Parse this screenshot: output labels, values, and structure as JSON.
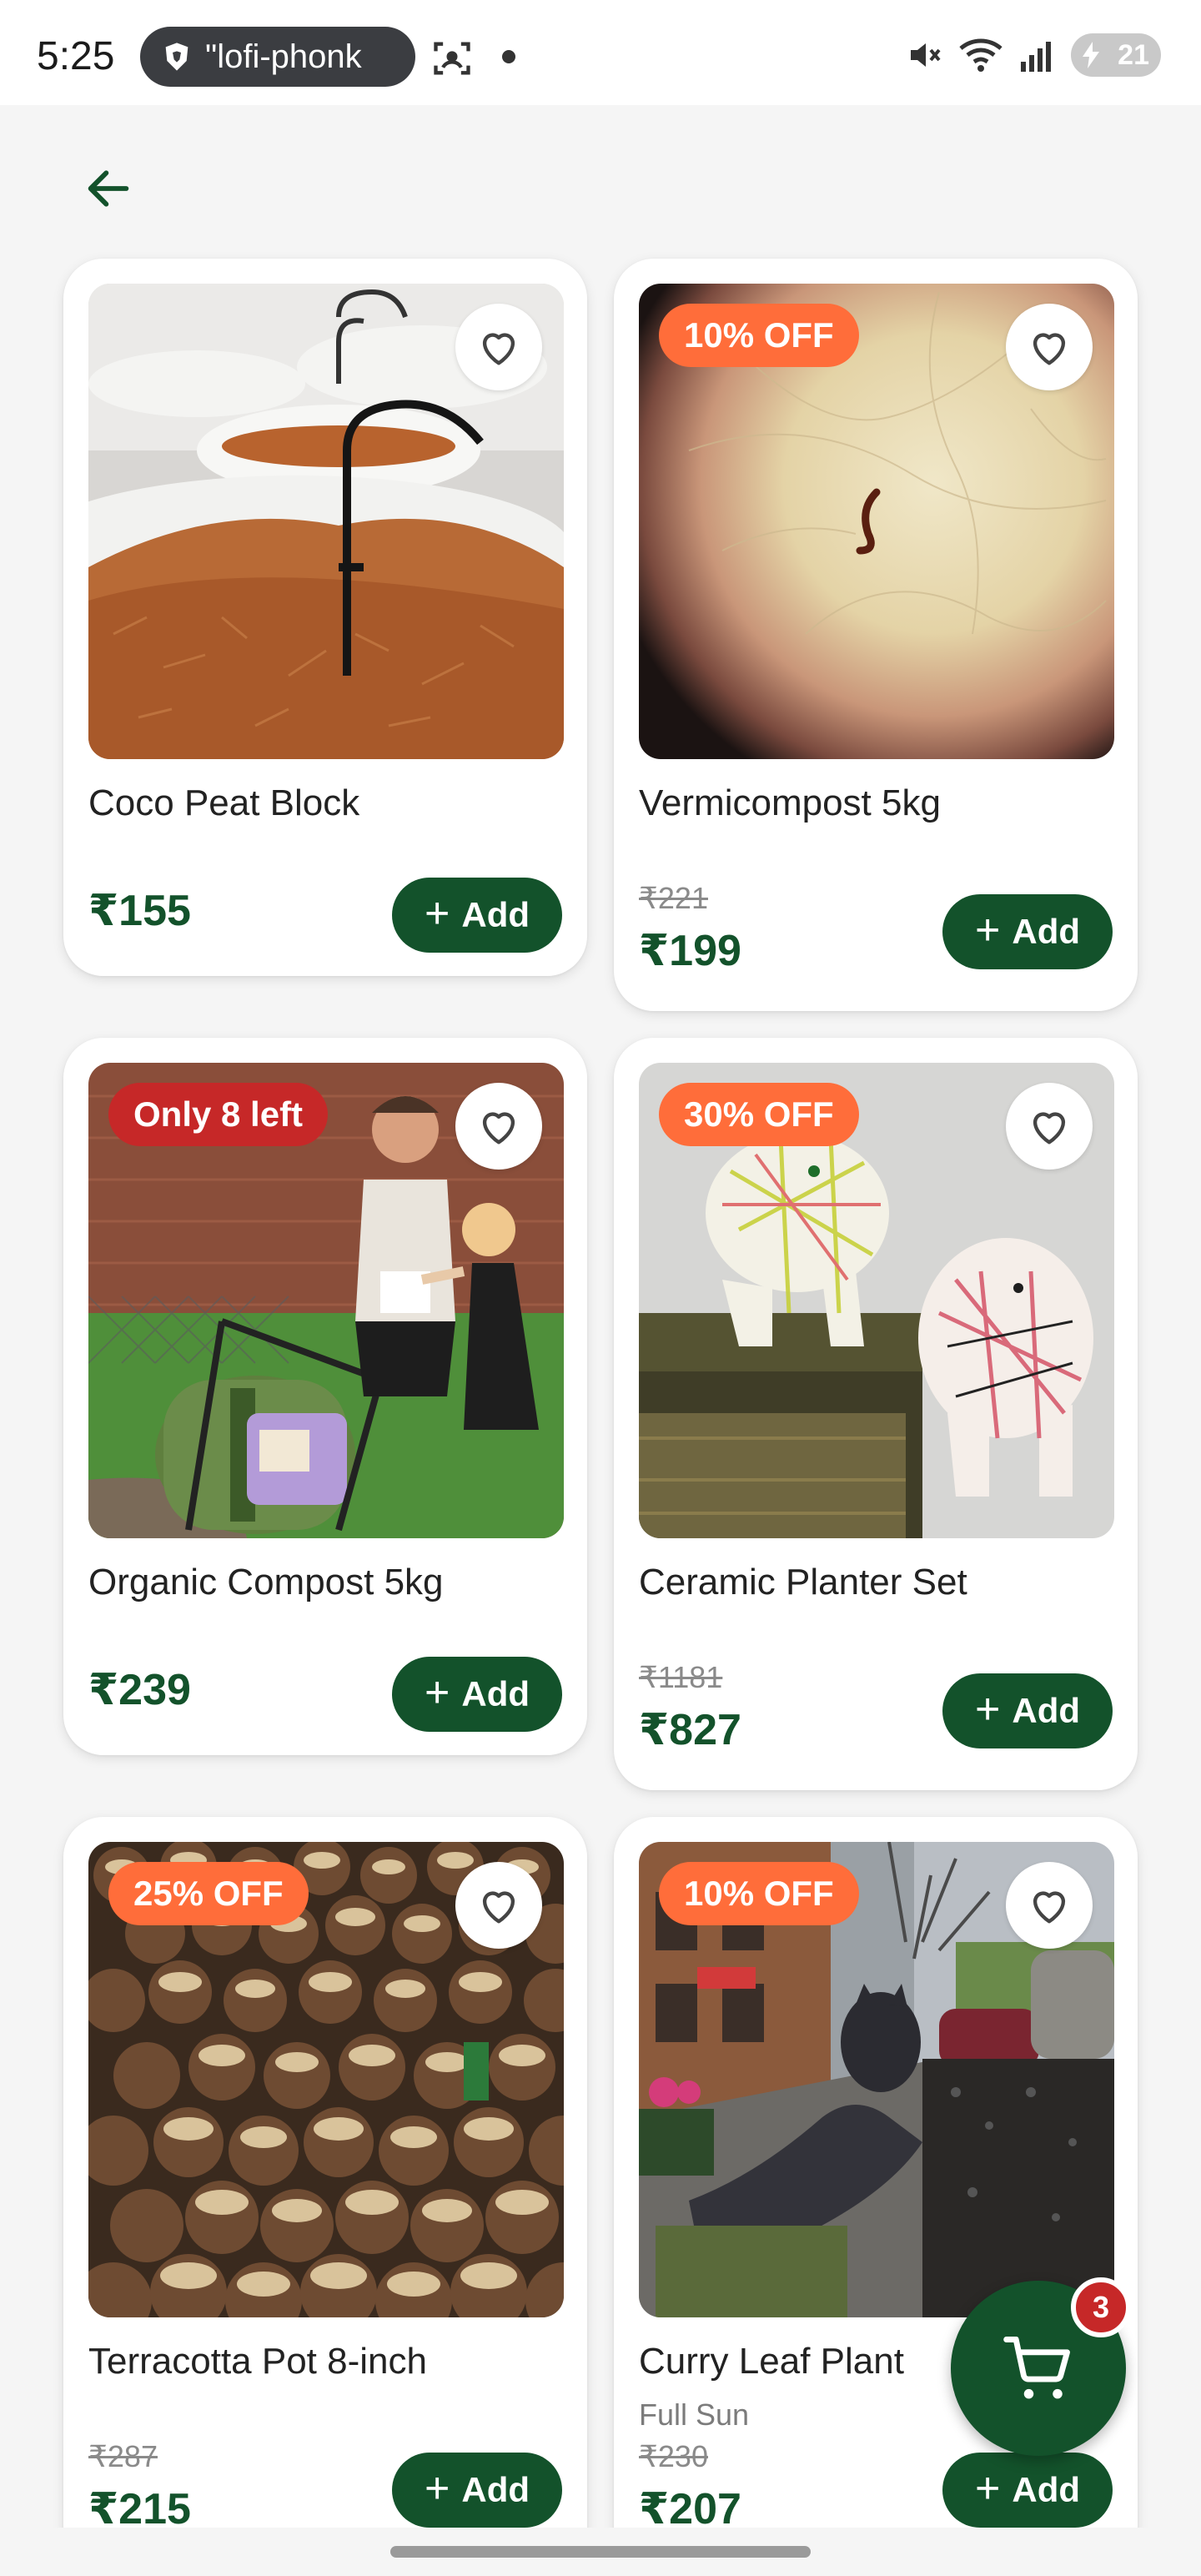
{
  "status_bar": {
    "time": "5:25",
    "url_text": "\"lofi-phonk",
    "battery": "21",
    "icons": [
      "brave-shield-icon",
      "screen-capture-icon",
      "mute-icon",
      "wifi-icon",
      "signal-icon",
      "battery-icon"
    ]
  },
  "app_bar": {
    "back_icon": "arrow-left-icon"
  },
  "colors": {
    "primary": "#13522b",
    "discount_badge": "#ff6d3a",
    "stock_badge": "#c62828",
    "price": "#13522b"
  },
  "products": [
    {
      "name": "Coco Peat Block",
      "subtitle": "",
      "badge": "",
      "mrp": "",
      "price": "₹155",
      "add_label": "Add"
    },
    {
      "name": "Vermicompost 5kg",
      "subtitle": "",
      "badge": "10% OFF",
      "mrp": "₹221",
      "price": "₹199",
      "add_label": "Add"
    },
    {
      "name": "Organic Compost 5kg",
      "subtitle": "",
      "badge": "Only 8 left",
      "mrp": "",
      "price": "₹239",
      "add_label": "Add"
    },
    {
      "name": "Ceramic Planter Set",
      "subtitle": "",
      "badge": "30% OFF",
      "mrp": "₹1181",
      "price": "₹827",
      "add_label": "Add"
    },
    {
      "name": "Terracotta Pot 8-inch",
      "subtitle": "",
      "badge": "25% OFF",
      "mrp": "₹287",
      "price": "₹215",
      "add_label": "Add"
    },
    {
      "name": "Curry Leaf Plant",
      "subtitle": "Full Sun",
      "badge": "10% OFF",
      "mrp": "₹230",
      "price": "₹207",
      "add_label": "Add"
    }
  ],
  "cart": {
    "count": "3",
    "icon": "cart-icon"
  }
}
